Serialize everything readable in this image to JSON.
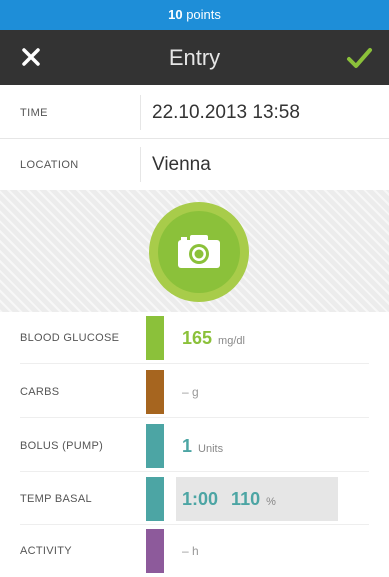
{
  "points_bar": {
    "count": "10",
    "label": "points"
  },
  "header": {
    "title": "Entry"
  },
  "fields": [
    {
      "label": "TIME",
      "value": "22.10.2013 13:58"
    },
    {
      "label": "LOCATION",
      "value": "Vienna"
    }
  ],
  "photo": {
    "icon": "camera-icon"
  },
  "log": {
    "blood_glucose": {
      "label": "BLOOD GLUCOSE",
      "value": "165",
      "unit": "mg/dl",
      "color": "#8bc13a"
    },
    "carbs": {
      "label": "CARBS",
      "placeholder": "– g",
      "color": "#a6651f"
    },
    "bolus": {
      "label": "BOLUS (PUMP)",
      "value": "1",
      "unit": "Units",
      "color": "#4ca5a4"
    },
    "temp_basal": {
      "label": "TEMP BASAL",
      "time": "1:00",
      "value": "110",
      "unit": "%",
      "color": "#4ca5a4"
    },
    "activity": {
      "label": "ACTIVITY",
      "placeholder": "– h",
      "color": "#8d5a9b"
    }
  },
  "colors": {
    "accent_blue": "#1e8ed8",
    "header_bg": "#333333",
    "check_green": "#8bc13a"
  }
}
